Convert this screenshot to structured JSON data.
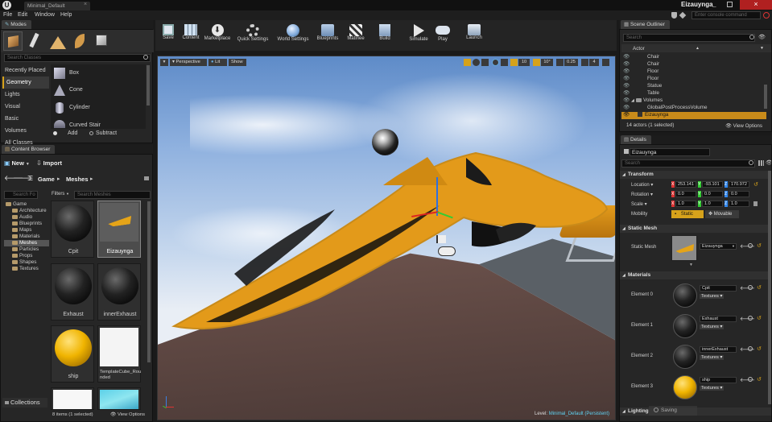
{
  "titlebar": {
    "tab_label": "Minimal_Default",
    "project_name": "Eizauynga",
    "console_placeholder": "Enter console command"
  },
  "menu": [
    "File",
    "Edit",
    "Window",
    "Help"
  ],
  "modes": {
    "title": "Modes",
    "search_placeholder": "Search Classes",
    "categories": [
      "Recently Placed",
      "Geometry",
      "Lights",
      "Visual",
      "Basic",
      "Volumes",
      "All Classes"
    ],
    "selected_category": "Geometry",
    "items": [
      "Box",
      "Cone",
      "Cylinder",
      "Curved Stair"
    ],
    "add_label": "Add",
    "subtract_label": "Subtract"
  },
  "toolbar": {
    "buttons": [
      "Save",
      "Content",
      "Marketplace",
      "Quick Settings",
      "World Settings",
      "Blueprints",
      "Matinee",
      "Build",
      "Simulate",
      "Play",
      "Launch"
    ]
  },
  "viewport": {
    "perspective_label": "Perspective",
    "lit_label": "Lit",
    "show_label": "Show",
    "grid_snap": "10",
    "rot_snap": "10°",
    "scale_snap": "0.25",
    "cam_speed": "4",
    "level_label": "Level:",
    "level_name": "Minimal_Default (Persistent)"
  },
  "content_browser": {
    "title": "Content Browser",
    "new_label": "New",
    "import_label": "Import",
    "path_root": "Game",
    "path_leaf": "Meshes",
    "tree_search_placeholder": "Search Fo",
    "filters_label": "Filters",
    "asset_search_placeholder": "Search Meshes",
    "tree": [
      "Game",
      "Architecture",
      "Audio",
      "Blueprints",
      "Maps",
      "Materials",
      "Meshes",
      "Particles",
      "Props",
      "Shapes",
      "Textures"
    ],
    "selected_folder": "Meshes",
    "assets": [
      "Cpit",
      "Eizauynga",
      "Exhaust",
      "innerExhaust",
      "ship",
      "TemplateCube_Rounded"
    ],
    "selected_asset": "Eizauynga",
    "collections_label": "Collections",
    "status": "8 items (1 selected)",
    "view_options": "View Options"
  },
  "outliner": {
    "title": "Scene Outliner",
    "search_placeholder": "Search",
    "column": "Actor",
    "rows": [
      "Chair",
      "Chair",
      "Floor",
      "Floor",
      "Statue",
      "Table",
      "Volumes",
      "GlobalPostProcessVolume",
      "Eizauynga"
    ],
    "selected_row": "Eizauynga",
    "status": "14 actors (1 selected)",
    "view_options": "View Options"
  },
  "details": {
    "title": "Details",
    "name_value": "Eizauynga",
    "search_placeholder": "Search",
    "transform_label": "Transform",
    "location_label": "Location",
    "location": [
      "253.141",
      "-93.101",
      "170.972"
    ],
    "rotation_label": "Rotation",
    "rotation": [
      "0.0",
      "0.0",
      "0.0"
    ],
    "scale_label": "Scale",
    "scale": [
      "1.0",
      "1.0",
      "1.0"
    ],
    "mobility_label": "Mobility",
    "static_label": "Static",
    "movable_label": "Movable",
    "static_mesh_section": "Static Mesh",
    "static_mesh_label": "Static Mesh",
    "static_mesh_value": "Eizauynga",
    "materials_section": "Materials",
    "elements": [
      {
        "label": "Element 0",
        "material": "Cpit",
        "textures": "Textures"
      },
      {
        "label": "Element 1",
        "material": "Exhaust",
        "textures": "Textures"
      },
      {
        "label": "Element 2",
        "material": "innerExhaust",
        "textures": "Textures"
      },
      {
        "label": "Element 3",
        "material": "ship",
        "textures": "Textures"
      }
    ],
    "lighting_section": "Lighting",
    "saving_label": "Saving"
  },
  "colors": {
    "accent": "#d6a21b",
    "selection": "#c98b1a",
    "ship": "#e39a1a",
    "sky": "#7fa6d8"
  }
}
